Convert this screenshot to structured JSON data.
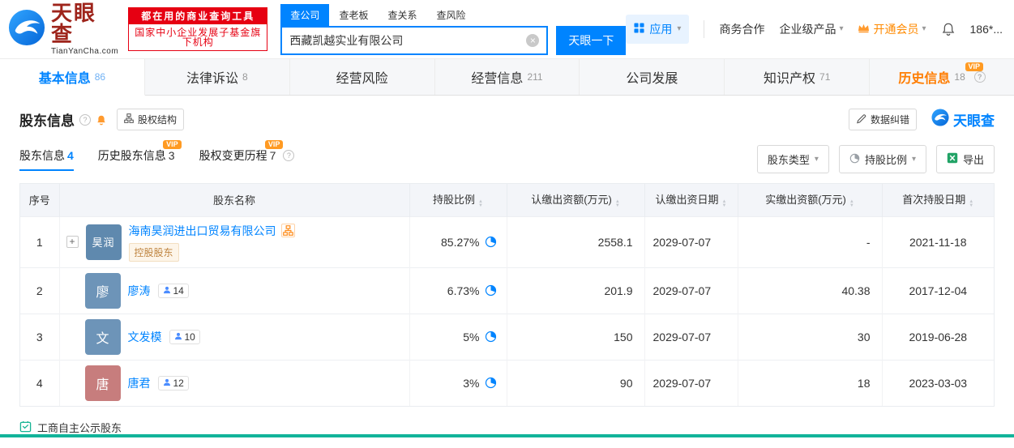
{
  "brand": {
    "name": "天眼查",
    "domain": "TianYanCha.com",
    "slogan_line1": "都在用的商业查询工具",
    "slogan_line2": "国家中小企业发展子基金旗下机构"
  },
  "search": {
    "tabs": [
      {
        "label": "查公司",
        "active": true
      },
      {
        "label": "查老板",
        "active": false
      },
      {
        "label": "查关系",
        "active": false
      },
      {
        "label": "查风险",
        "active": false
      }
    ],
    "value": "西藏凯越实业有限公司",
    "button_label": "天眼一下"
  },
  "header_menu": {
    "apps": "应用",
    "business_coop": "商务合作",
    "enterprise_products": "企业级产品",
    "open_vip": "开通会员",
    "phone": "186*..."
  },
  "labels": {
    "vip": "VIP"
  },
  "icons": {
    "caret_down": "▾",
    "clear": "×",
    "expand_plus": "+",
    "help": "?"
  },
  "nav_tabs": [
    {
      "label": "基本信息",
      "count": "86"
    },
    {
      "label": "法律诉讼",
      "count": "8"
    },
    {
      "label": "经营风险",
      "count": ""
    },
    {
      "label": "经营信息",
      "count": "211"
    },
    {
      "label": "公司发展",
      "count": ""
    },
    {
      "label": "知识产权",
      "count": "71"
    },
    {
      "label": "历史信息",
      "count": "18"
    }
  ],
  "section": {
    "title": "股东信息",
    "equity_structure_label": "股权结构",
    "data_correction_label": "数据纠错",
    "watermark_brand": "天眼查"
  },
  "subtabs": [
    {
      "label": "股东信息",
      "count": "4"
    },
    {
      "label": "历史股东信息",
      "count": "3"
    },
    {
      "label": "股权变更历程",
      "count": "7"
    }
  ],
  "filters": {
    "shareholder_type": "股东类型",
    "holding_ratio": "持股比例",
    "export_label": "导出"
  },
  "table": {
    "headers": {
      "no": "序号",
      "name": "股东名称",
      "ratio": "持股比例",
      "subscribed_amount": "认缴出资额(万元)",
      "subscribed_date": "认缴出资日期",
      "paid_amount": "实缴出资额(万元)",
      "first_date": "首次持股日期"
    },
    "rows": [
      {
        "no": "1",
        "avatar_text": "昊润",
        "avatar_color": "#5f89ae",
        "name": "海南昊润进出口贸易有限公司",
        "tag": "控股股东",
        "ratio": "85.27%",
        "subscribed_amount": "2558.1",
        "subscribed_date": "2029-07-07",
        "paid_amount": "-",
        "first_date": "2021-11-18"
      },
      {
        "no": "2",
        "avatar_text": "廖",
        "avatar_color": "#6d94b8",
        "name": "廖涛",
        "badge_count": "14",
        "ratio": "6.73%",
        "subscribed_amount": "201.9",
        "subscribed_date": "2029-07-07",
        "paid_amount": "40.38",
        "first_date": "2017-12-04"
      },
      {
        "no": "3",
        "avatar_text": "文",
        "avatar_color": "#6d94b8",
        "name": "文发模",
        "badge_count": "10",
        "ratio": "5%",
        "subscribed_amount": "150",
        "subscribed_date": "2029-07-07",
        "paid_amount": "30",
        "first_date": "2019-06-28"
      },
      {
        "no": "4",
        "avatar_text": "唐",
        "avatar_color": "#c77d7d",
        "name": "唐君",
        "badge_count": "12",
        "ratio": "3%",
        "subscribed_amount": "90",
        "subscribed_date": "2029-07-07",
        "paid_amount": "18",
        "first_date": "2023-03-03"
      }
    ]
  },
  "footer": {
    "note": "工商自主公示股东"
  },
  "colors": {
    "primary_blue": "#0084ff",
    "brand_red": "#e60012",
    "vip_orange": "#ff9a22",
    "history_tab_orange": "#ff7d00",
    "table_header_bg": "#f3f5f9",
    "bottom_bar_teal": "#12b39a"
  }
}
